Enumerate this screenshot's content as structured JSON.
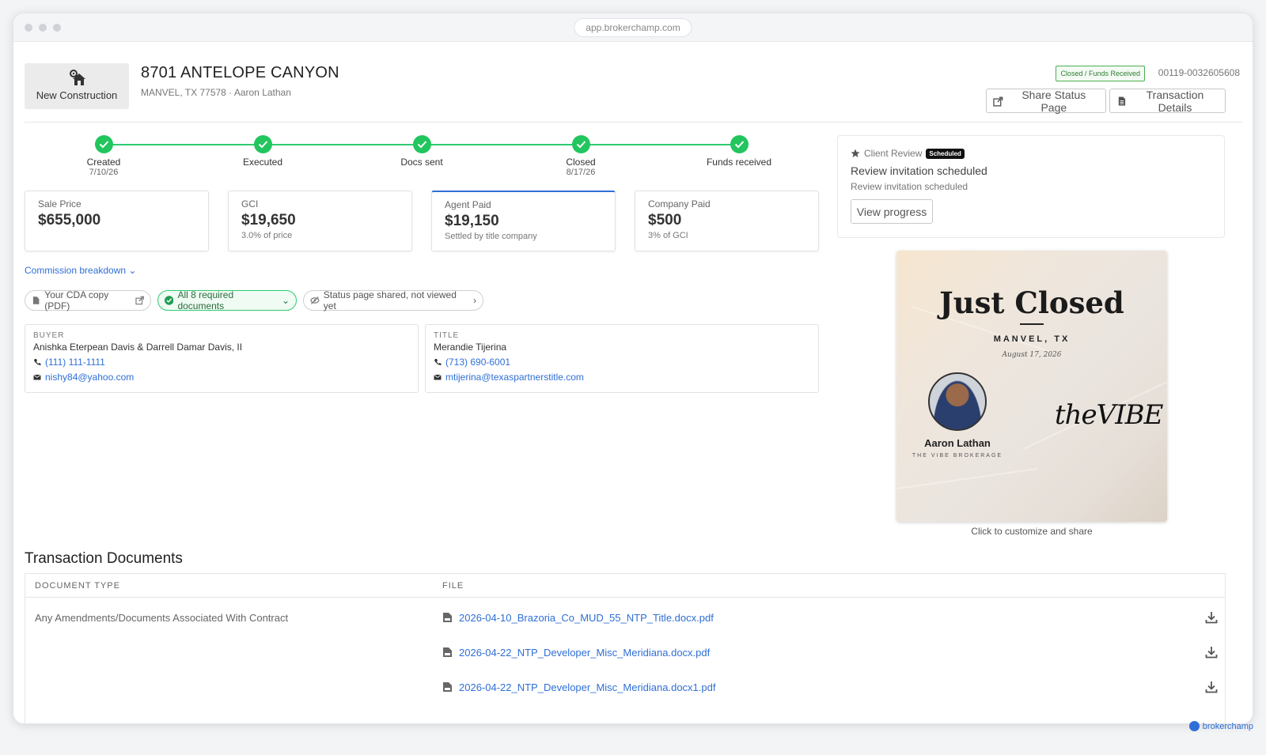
{
  "browser": {
    "url": "app.brokerchamp.com"
  },
  "header": {
    "type_label": "New Construction",
    "address": "8701 ANTELOPE CANYON",
    "subline": "MANVEL, TX 77578 · Aaron Lathan",
    "status_badge": "Closed / Funds Received",
    "transaction_id": "00119-0032605608",
    "share_button": "Share Status Page",
    "details_button": "Transaction Details"
  },
  "timeline": [
    {
      "name": "Created",
      "date": "7/10/26"
    },
    {
      "name": "Executed",
      "date": ""
    },
    {
      "name": "Docs sent",
      "date": ""
    },
    {
      "name": "Closed",
      "date": "8/17/26"
    },
    {
      "name": "Funds received",
      "date": ""
    }
  ],
  "money": [
    {
      "title": "Sale Price",
      "value": "$655,000",
      "note": ""
    },
    {
      "title": "GCI",
      "value": "$19,650",
      "note": "3.0% of price"
    },
    {
      "title": "Agent Paid",
      "value": "$19,150",
      "note": "Settled by title company"
    },
    {
      "title": "Company Paid",
      "value": "$500",
      "note": "3% of GCI"
    }
  ],
  "commission_breakdown": "Commission breakdown",
  "pills": {
    "cda": "Your CDA copy (PDF)",
    "docs": "All 8 required documents",
    "status": "Status page shared, not viewed yet"
  },
  "contacts": {
    "buyer": {
      "role": "BUYER",
      "name": "Anishka Eterpean Davis & Darrell Damar Davis, II",
      "phone": "(111) 111-1111",
      "email": "nishy84@yahoo.com"
    },
    "title": {
      "role": "TITLE",
      "name": "Merandie Tijerina",
      "phone": "(713) 690-6001",
      "email": "mtijerina@texaspartnerstitle.com"
    }
  },
  "review": {
    "label": "Client Review",
    "badge": "Scheduled",
    "title": "Review invitation scheduled",
    "subtitle": "Review invitation scheduled",
    "button": "View progress"
  },
  "graphic": {
    "title": "Just Closed",
    "city": "MANVEL, TX",
    "date": "August 17, 2026",
    "agent": "Aaron Lathan",
    "brokerage": "THE VIBE BROKERAGE",
    "logo": "theVIBE",
    "caption": "Click to customize and share"
  },
  "documents": {
    "title": "Transaction Documents",
    "col_type": "DOCUMENT TYPE",
    "col_file": "FILE",
    "doc_type": "Any Amendments/Documents Associated With Contract",
    "files": [
      "2026-04-10_Brazoria_Co_MUD_55_NTP_Title.docx.pdf",
      "2026-04-22_NTP_Developer_Misc_Meridiana.docx.pdf",
      "2026-04-22_NTP_Developer_Misc_Meridiana.docx1.pdf"
    ]
  },
  "footer_brand": "brokerchamp",
  "colors": {
    "accent": "#2f6fd6",
    "success": "#22c55e",
    "badge_border": "#4caf50"
  }
}
